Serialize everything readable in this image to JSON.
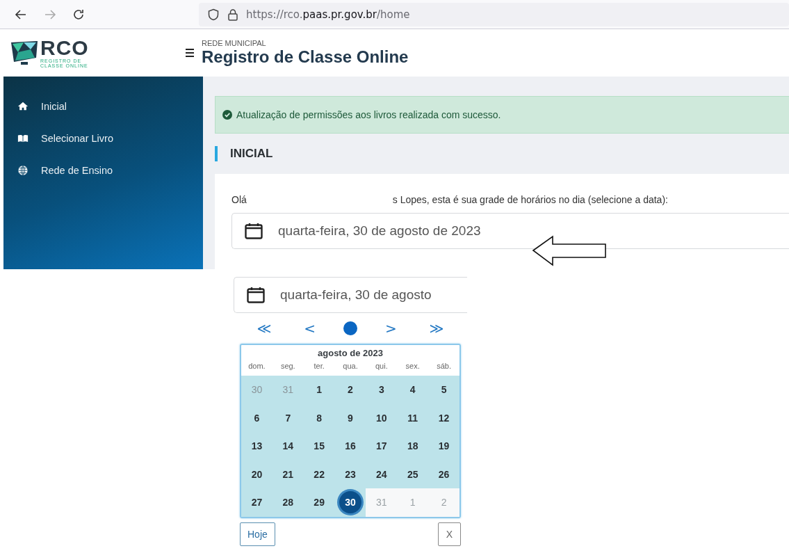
{
  "browser": {
    "url_prefix": "https://rco.",
    "url_domain": "paas.pr.gov.br",
    "url_suffix": "/home"
  },
  "header": {
    "logo_text": "RCO",
    "logo_subtitle_1": "REGISTRO DE",
    "logo_subtitle_2": "CLASSE ONLINE",
    "overline": "REDE MUNICIPAL",
    "title": "Registro de Classe Online"
  },
  "sidebar": {
    "items": [
      {
        "label": "Inicial"
      },
      {
        "label": "Selecionar Livro"
      },
      {
        "label": "Rede de Ensino"
      }
    ]
  },
  "alert": {
    "kind": "success",
    "text": "Atualização de permissões aos livros realizada com sucesso."
  },
  "section_title": "INICIAL",
  "greeting": {
    "start": "Olá",
    "end": "s Lopes, esta é sua grade de horários no dia (selecione a data):"
  },
  "date_field": {
    "value": "quarta-feira, 30 de agosto de 2023"
  },
  "datepicker": {
    "field_value": "quarta-feira, 30 de agosto",
    "nav": {
      "prev_year": "≪",
      "prev_month": "<",
      "next_month": ">",
      "next_year": "≫"
    },
    "month_title": "agosto de 2023",
    "weekdays": [
      "dom.",
      "seg.",
      "ter.",
      "qua.",
      "qui.",
      "sex.",
      "sáb."
    ],
    "weeks": [
      [
        {
          "label": "30",
          "outside": true,
          "highlighted": true,
          "selected": false
        },
        {
          "label": "31",
          "outside": true,
          "highlighted": true,
          "selected": false
        },
        {
          "label": "1",
          "outside": false,
          "highlighted": true,
          "selected": false
        },
        {
          "label": "2",
          "outside": false,
          "highlighted": true,
          "selected": false
        },
        {
          "label": "3",
          "outside": false,
          "highlighted": true,
          "selected": false
        },
        {
          "label": "4",
          "outside": false,
          "highlighted": true,
          "selected": false
        },
        {
          "label": "5",
          "outside": false,
          "highlighted": true,
          "selected": false
        }
      ],
      [
        {
          "label": "6",
          "outside": false,
          "highlighted": true,
          "selected": false
        },
        {
          "label": "7",
          "outside": false,
          "highlighted": true,
          "selected": false
        },
        {
          "label": "8",
          "outside": false,
          "highlighted": true,
          "selected": false
        },
        {
          "label": "9",
          "outside": false,
          "highlighted": true,
          "selected": false
        },
        {
          "label": "10",
          "outside": false,
          "highlighted": true,
          "selected": false
        },
        {
          "label": "11",
          "outside": false,
          "highlighted": true,
          "selected": false
        },
        {
          "label": "12",
          "outside": false,
          "highlighted": true,
          "selected": false
        }
      ],
      [
        {
          "label": "13",
          "outside": false,
          "highlighted": true,
          "selected": false
        },
        {
          "label": "14",
          "outside": false,
          "highlighted": true,
          "selected": false
        },
        {
          "label": "15",
          "outside": false,
          "highlighted": true,
          "selected": false
        },
        {
          "label": "16",
          "outside": false,
          "highlighted": true,
          "selected": false
        },
        {
          "label": "17",
          "outside": false,
          "highlighted": true,
          "selected": false
        },
        {
          "label": "18",
          "outside": false,
          "highlighted": true,
          "selected": false
        },
        {
          "label": "19",
          "outside": false,
          "highlighted": true,
          "selected": false
        }
      ],
      [
        {
          "label": "20",
          "outside": false,
          "highlighted": true,
          "selected": false
        },
        {
          "label": "21",
          "outside": false,
          "highlighted": true,
          "selected": false
        },
        {
          "label": "22",
          "outside": false,
          "highlighted": true,
          "selected": false
        },
        {
          "label": "23",
          "outside": false,
          "highlighted": true,
          "selected": false
        },
        {
          "label": "24",
          "outside": false,
          "highlighted": true,
          "selected": false
        },
        {
          "label": "25",
          "outside": false,
          "highlighted": true,
          "selected": false
        },
        {
          "label": "26",
          "outside": false,
          "highlighted": true,
          "selected": false
        }
      ],
      [
        {
          "label": "27",
          "outside": false,
          "highlighted": true,
          "selected": false
        },
        {
          "label": "28",
          "outside": false,
          "highlighted": true,
          "selected": false
        },
        {
          "label": "29",
          "outside": false,
          "highlighted": true,
          "selected": false
        },
        {
          "label": "30",
          "outside": false,
          "highlighted": true,
          "selected": true
        },
        {
          "label": "31",
          "outside": true,
          "highlighted": false,
          "selected": false
        },
        {
          "label": "1",
          "outside": true,
          "highlighted": false,
          "selected": false
        },
        {
          "label": "2",
          "outside": true,
          "highlighted": false,
          "selected": false
        }
      ]
    ],
    "today_button": "Hoje",
    "close_button": "X"
  }
}
